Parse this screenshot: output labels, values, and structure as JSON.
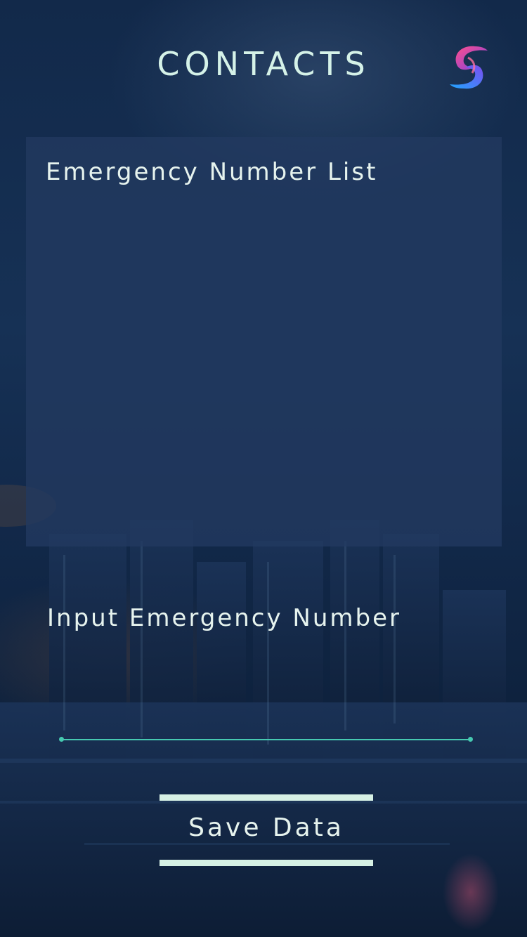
{
  "header": {
    "title": "CONTACTS",
    "logo_icon": "swirl-logo-icon"
  },
  "list_panel": {
    "title": "Emergency Number List",
    "items": []
  },
  "input": {
    "label": "Input Emergency Number",
    "value": "",
    "placeholder": ""
  },
  "actions": {
    "save_label": "Save Data"
  },
  "colors": {
    "accent": "#46c9b1",
    "text": "#e6f3ee",
    "panel": "#223a60",
    "background": "#12294a"
  }
}
